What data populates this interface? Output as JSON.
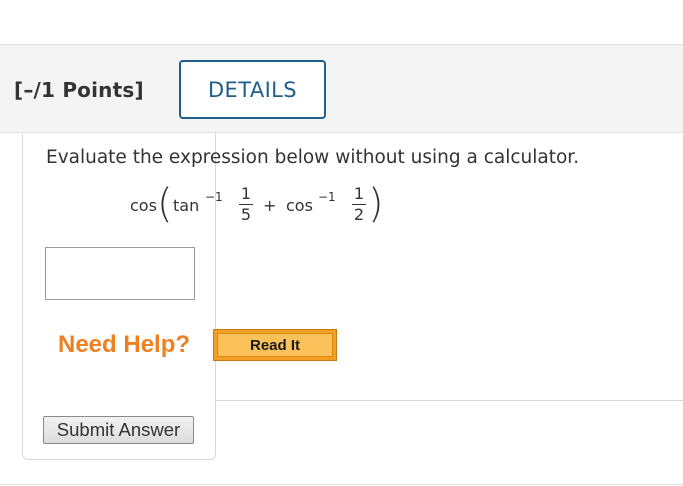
{
  "header": {
    "points_label": "[–/1 Points]",
    "details_button": "DETAILS"
  },
  "question": {
    "prompt": "Evaluate the expression below without using a calculator.",
    "expression": {
      "cos": "cos",
      "tan": "tan",
      "sup_tan": "−1",
      "frac1_num": "1",
      "frac1_den": "5",
      "plus": "+",
      "cos2": "cos",
      "sup_cos": "−1",
      "frac2_num": "1",
      "frac2_den": "2"
    },
    "answer_value": ""
  },
  "help": {
    "need_help_label": "Need Help?",
    "read_it_button": "Read It"
  },
  "actions": {
    "submit_button": "Submit Answer"
  },
  "colors": {
    "details_border": "#1f5f8b",
    "need_help": "#f07f1f",
    "read_it_bg": "#fbc15a"
  }
}
